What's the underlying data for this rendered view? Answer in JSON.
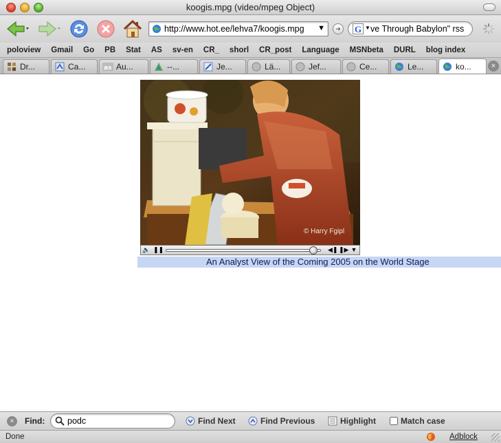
{
  "window": {
    "title": "koogis.mpg (video/mpeg Object)"
  },
  "nav": {
    "url": "http://www.hot.ee/lehva7/koogis.mpg",
    "search_value": "ve Through Babylon\" rss"
  },
  "bookmarks": [
    "poloview",
    "Gmail",
    "Go",
    "PB",
    "Stat",
    "AS",
    "sv-en",
    "CR_",
    "shorl",
    "CR_post",
    "Language",
    "MSNbeta",
    "DURL",
    "blog index"
  ],
  "tabs": [
    {
      "label": "Dr...",
      "icon": "dr-icon"
    },
    {
      "label": "Ca...",
      "icon": "ca-icon"
    },
    {
      "label": "Au...",
      "icon": "as-icon"
    },
    {
      "label": "--...",
      "icon": "triangle-icon"
    },
    {
      "label": "Je...",
      "icon": "je-icon"
    },
    {
      "label": "Lä...",
      "icon": "gray-globe-icon"
    },
    {
      "label": "Jef...",
      "icon": "gray-globe-icon"
    },
    {
      "label": "Ce...",
      "icon": "gray-globe-icon"
    },
    {
      "label": "Le...",
      "icon": "globe-icon"
    },
    {
      "label": "ko...",
      "icon": "globe-icon"
    }
  ],
  "video": {
    "watermark": "© Harry Fgipl",
    "progress": 0.95,
    "caption": "An Analyst View of the Coming 2005 on the World Stage"
  },
  "find": {
    "label": "Find:",
    "value": "podc",
    "next": "Find Next",
    "previous": "Find Previous",
    "highlight": "Highlight",
    "match_case": "Match case"
  },
  "status": {
    "text": "Done",
    "adblock": "Adblock"
  }
}
